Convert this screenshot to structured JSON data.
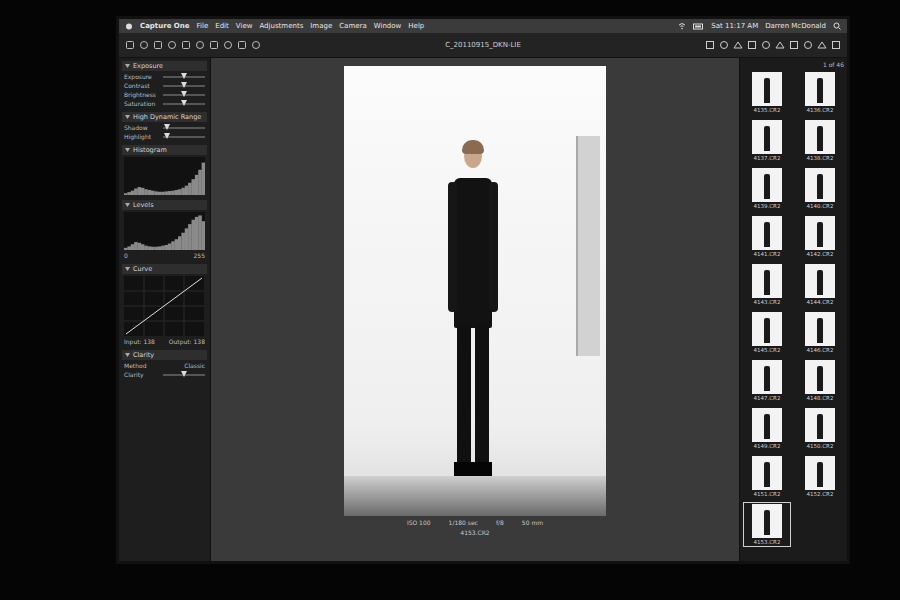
{
  "menubar": {
    "app": "Capture One",
    "items": [
      "File",
      "Edit",
      "View",
      "Adjustments",
      "Image",
      "Camera",
      "Window",
      "Help"
    ],
    "clock": "Sat 11:17 AM",
    "user": "Darren McDonald"
  },
  "window": {
    "title": "C_20110915_DKN-LIE"
  },
  "tools": {
    "exposure": {
      "title": "Exposure",
      "sliders": [
        {
          "label": "Exposure",
          "level": 0.5
        },
        {
          "label": "Contrast",
          "level": 0.5
        },
        {
          "label": "Brightness",
          "level": 0.5
        },
        {
          "label": "Saturation",
          "level": 0.5
        }
      ]
    },
    "hdr": {
      "title": "High Dynamic Range",
      "sliders": [
        {
          "label": "Shadow",
          "level": 0.1
        },
        {
          "label": "Highlight",
          "level": 0.1
        }
      ]
    },
    "histogram": {
      "title": "Histogram",
      "values": [
        5,
        8,
        12,
        18,
        22,
        20,
        16,
        14,
        12,
        10,
        9,
        9,
        10,
        11,
        12,
        14,
        16,
        20,
        26,
        34,
        44,
        56,
        70,
        90
      ]
    },
    "levels": {
      "title": "Levels",
      "values": [
        6,
        10,
        16,
        22,
        20,
        16,
        12,
        10,
        9,
        9,
        10,
        12,
        14,
        18,
        24,
        30,
        38,
        48,
        60,
        72,
        84,
        92,
        96,
        80
      ],
      "low": "0",
      "high": "255"
    },
    "curve": {
      "title": "Curve",
      "input": "Input: 138",
      "output": "Output: 138"
    },
    "clarity": {
      "title": "Clarity",
      "method": "Method",
      "method_value": "Classic",
      "sliders": [
        {
          "label": "Clarity",
          "level": 0.5
        }
      ]
    }
  },
  "viewer": {
    "filename": "4153.CR2",
    "info": [
      "ISO 100",
      "1/180 sec",
      "f/8",
      "50 mm"
    ]
  },
  "browser": {
    "count": "1 of 46",
    "thumbs": [
      {
        "label": "4135.CR2",
        "selected": false
      },
      {
        "label": "4136.CR2",
        "selected": false
      },
      {
        "label": "4137.CR2",
        "selected": false
      },
      {
        "label": "4138.CR2",
        "selected": false
      },
      {
        "label": "4139.CR2",
        "selected": false
      },
      {
        "label": "4140.CR2",
        "selected": false
      },
      {
        "label": "4141.CR2",
        "selected": false
      },
      {
        "label": "4142.CR2",
        "selected": false
      },
      {
        "label": "4143.CR2",
        "selected": false
      },
      {
        "label": "4144.CR2",
        "selected": false
      },
      {
        "label": "4145.CR2",
        "selected": false
      },
      {
        "label": "4146.CR2",
        "selected": false
      },
      {
        "label": "4147.CR2",
        "selected": false
      },
      {
        "label": "4148.CR2",
        "selected": false
      },
      {
        "label": "4149.CR2",
        "selected": false
      },
      {
        "label": "4150.CR2",
        "selected": false
      },
      {
        "label": "4151.CR2",
        "selected": false
      },
      {
        "label": "4152.CR2",
        "selected": false
      },
      {
        "label": "4153.CR2",
        "selected": true
      }
    ]
  }
}
